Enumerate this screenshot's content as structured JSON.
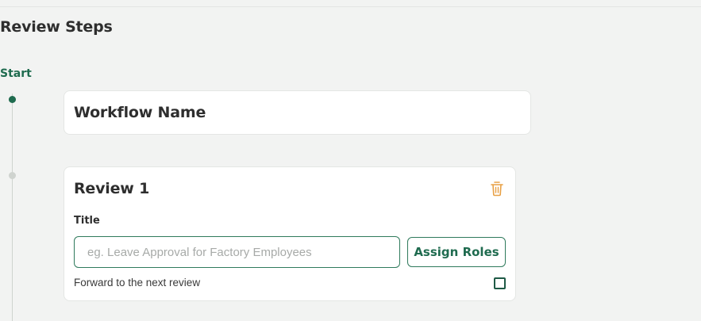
{
  "section": {
    "title": "Review Steps",
    "start_label": "Start"
  },
  "workflow": {
    "name_label": "Workflow Name"
  },
  "review": {
    "title": "Review 1",
    "field_label": "Title",
    "input_value": "",
    "input_placeholder": "eg. Leave Approval for Factory Employees",
    "assign_button": "Assign Roles",
    "forward_label": "Forward to the next review",
    "forward_checked": false
  },
  "colors": {
    "accent": "#1f6b4f",
    "trash": "#e8a045",
    "background": "#f2f3f2"
  },
  "icons": {
    "delete": "trash-icon"
  }
}
